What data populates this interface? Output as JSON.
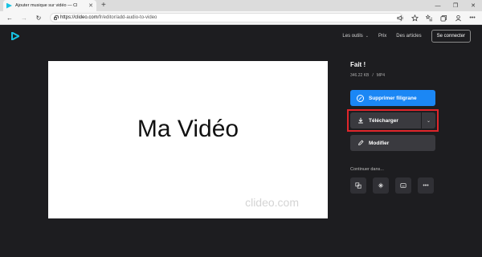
{
  "browser": {
    "tab_title": "Ajouter musique sur vidéo — Cl",
    "tab_close": "✕",
    "new_tab": "+",
    "url_host": "https://clideo.com",
    "url_path": "/fr/editor/add-audio-to-video",
    "win_minimize": "—",
    "win_maximize": "❐",
    "win_close": "✕"
  },
  "header": {
    "nav": [
      {
        "label": "Les outils",
        "caret": "⌄"
      },
      {
        "label": "Prix"
      },
      {
        "label": "Des articles"
      }
    ],
    "connect_label": "Se connecter"
  },
  "preview": {
    "text": "Ma Vidéo",
    "watermark": "clideo.com"
  },
  "panel": {
    "title": "Fait !",
    "file_size": "346.22 KB",
    "separator": "/",
    "file_format": "MP4",
    "remove_watermark_label": "Supprimer filigrane",
    "download_label": "Télécharger",
    "edit_label": "Modifier",
    "continue_label": "Continuer dans..."
  },
  "icons": {
    "back": "←",
    "forward": "→",
    "reload": "↻",
    "dl_more": "⌄",
    "more": "•••"
  },
  "colors": {
    "accent": "#1b87f5",
    "logo": "#17c3e3",
    "highlight": "#e0262b",
    "background": "#1d1d20"
  }
}
